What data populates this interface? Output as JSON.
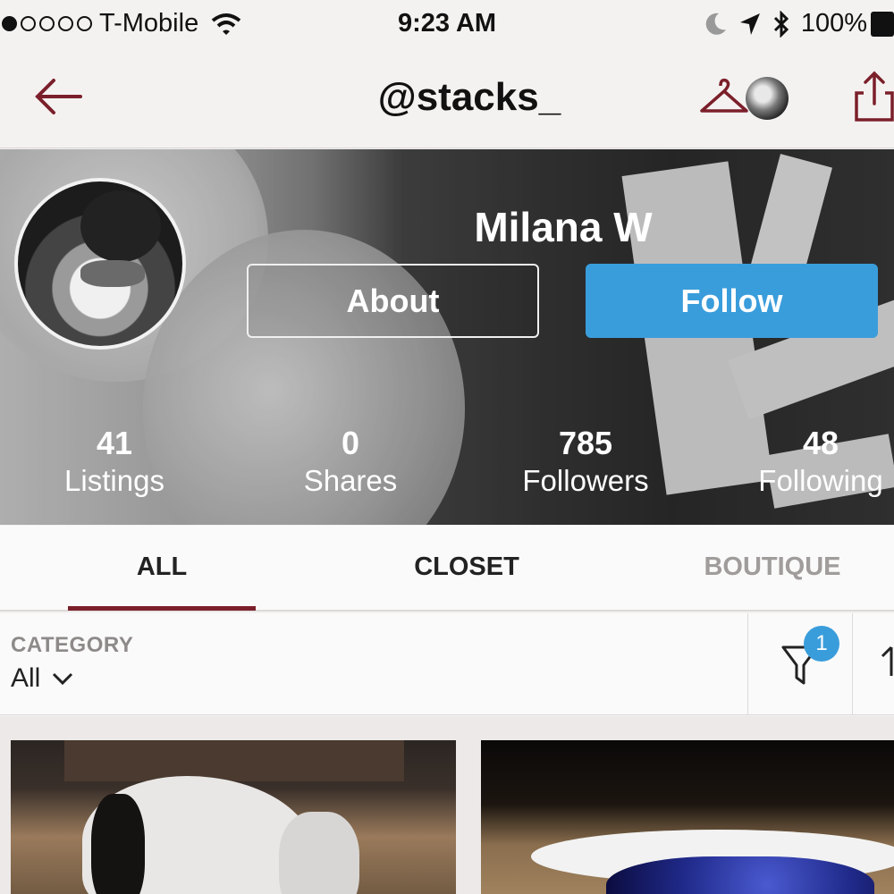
{
  "status_bar": {
    "carrier": "T-Mobile",
    "time": "9:23 AM",
    "battery": "100%"
  },
  "nav": {
    "title": "@stacks_"
  },
  "profile": {
    "name": "Milana W",
    "about_label": "About",
    "follow_label": "Follow",
    "stats": [
      {
        "value": "41",
        "label": "Listings"
      },
      {
        "value": "0",
        "label": "Shares"
      },
      {
        "value": "785",
        "label": "Followers"
      },
      {
        "value": "48",
        "label": "Following"
      }
    ]
  },
  "tabs": [
    {
      "label": "ALL",
      "active": true
    },
    {
      "label": "CLOSET",
      "active": false
    },
    {
      "label": "BOUTIQUE",
      "active": false
    }
  ],
  "filter": {
    "category_label": "CATEGORY",
    "category_value": "All",
    "badge_count": "1"
  },
  "colors": {
    "accent": "#7b1f2a",
    "follow_blue": "#3a9ddb",
    "inactive_tab": "#a09c9b"
  },
  "icons": {
    "back": "arrow-left-icon",
    "hanger": "hanger-icon",
    "share": "share-icon",
    "filter": "filter-funnel-icon",
    "sort": "sort-icon",
    "dropdown": "chevron-down-icon"
  }
}
